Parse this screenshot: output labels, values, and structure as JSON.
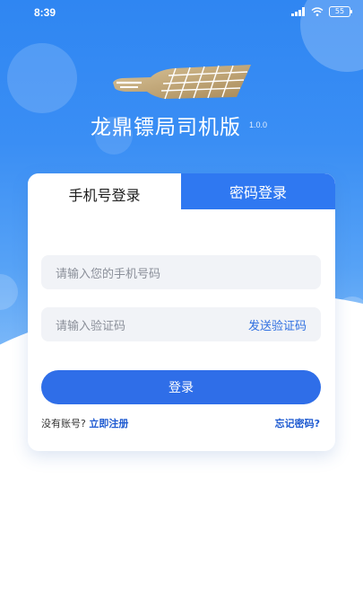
{
  "status_bar": {
    "time": "8:39",
    "battery": "55"
  },
  "app": {
    "title": "龙鼎镖局司机版",
    "version": "1.0.0"
  },
  "tabs": [
    {
      "label": "手机号登录",
      "active": true
    },
    {
      "label": "密码登录",
      "active": false
    }
  ],
  "form": {
    "phone_placeholder": "请输入您的手机号码",
    "code_placeholder": "请输入验证码",
    "send_code_label": "发送验证码",
    "login_label": "登录",
    "no_account_text": "没有账号?",
    "register_label": "立即注册",
    "forgot_label": "忘记密码?"
  },
  "colors": {
    "primary": "#2f6ee8",
    "hero_top": "#2f86f2",
    "link": "#1f5bd1"
  },
  "icons": [
    "signal-icon",
    "wifi-icon",
    "battery-icon",
    "app-logo"
  ]
}
